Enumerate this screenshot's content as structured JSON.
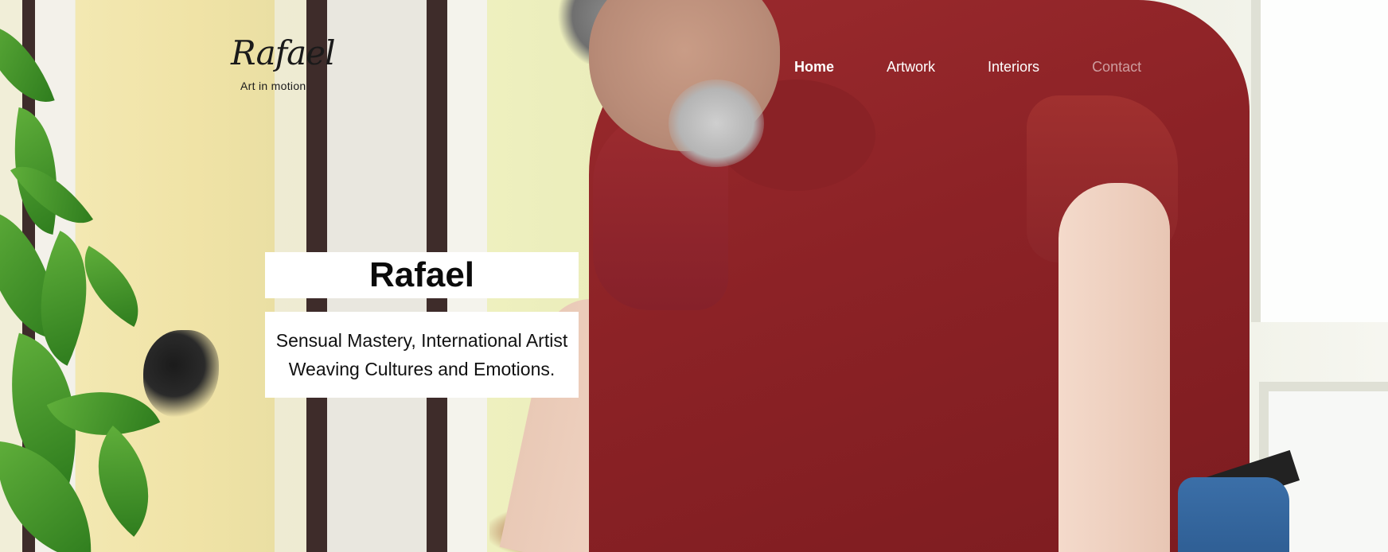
{
  "logo": {
    "script": "Rafael",
    "tagline": "Art in motion"
  },
  "nav": {
    "items": [
      {
        "label": "Home",
        "state": "active"
      },
      {
        "label": "Artwork",
        "state": "default"
      },
      {
        "label": "Interiors",
        "state": "default"
      },
      {
        "label": "Contact",
        "state": "muted"
      }
    ]
  },
  "hero": {
    "title": "Rafael",
    "subtitle": "Sensual Mastery, International Artist Weaving Cultures and Emotions."
  },
  "colors": {
    "shirt": "#8c2226",
    "text_dark": "#0b0b0b",
    "nav_text": "#ffffff",
    "box_bg": "#ffffff"
  }
}
